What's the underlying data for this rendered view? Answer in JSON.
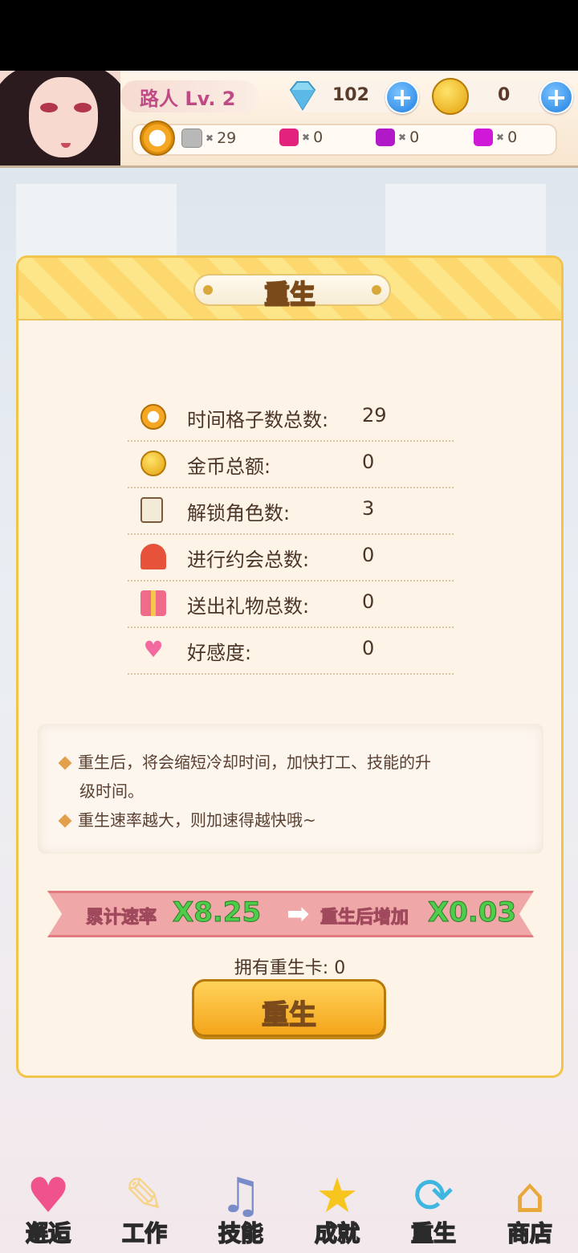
{
  "header": {
    "player_name": "路人 Lv. 2",
    "gems": "102",
    "coins": "0",
    "resources": [
      {
        "icon": "gray-gem-icon",
        "count": "29"
      },
      {
        "icon": "pink-gem-icon",
        "count": "0"
      },
      {
        "icon": "purple-gem-icon",
        "count": "0"
      },
      {
        "icon": "violet-gem-icon",
        "count": "0"
      }
    ],
    "times_symbol": "✖",
    "plus": "+"
  },
  "panel": {
    "title": "重生",
    "stats": [
      {
        "icon": "stopwatch-icon",
        "label": "时间格子数总数:",
        "value": "29"
      },
      {
        "icon": "coin-icon",
        "label": "金币总额:",
        "value": "0"
      },
      {
        "icon": "character-card-icon",
        "label": "解锁角色数:",
        "value": "3"
      },
      {
        "icon": "heartbeat-icon",
        "label": "进行约会总数:",
        "value": "0"
      },
      {
        "icon": "gift-icon",
        "label": "送出礼物总数:",
        "value": "0"
      },
      {
        "icon": "heart-icon",
        "label": "好感度:",
        "value": "0"
      }
    ],
    "notes": [
      "重生后，将会缩短冷却时间，加快打工、技能的升",
      "级时间。",
      "重生速率越大，则加速得越快哦~"
    ],
    "ribbon": {
      "cumulative_label": "累计速率",
      "cumulative_value": "X8.25",
      "after_label": "重生后增加",
      "after_value": "X0.03"
    },
    "card_text": "拥有重生卡: 0",
    "button_label": "重生"
  },
  "nav": [
    {
      "label": "邂逅",
      "icon": "hearts-icon"
    },
    {
      "label": "工作",
      "icon": "notepad-icon"
    },
    {
      "label": "技能",
      "icon": "microphone-icon"
    },
    {
      "label": "成就",
      "icon": "star-icon"
    },
    {
      "label": "重生",
      "icon": "refresh-icon"
    },
    {
      "label": "商店",
      "icon": "shop-icon"
    }
  ]
}
